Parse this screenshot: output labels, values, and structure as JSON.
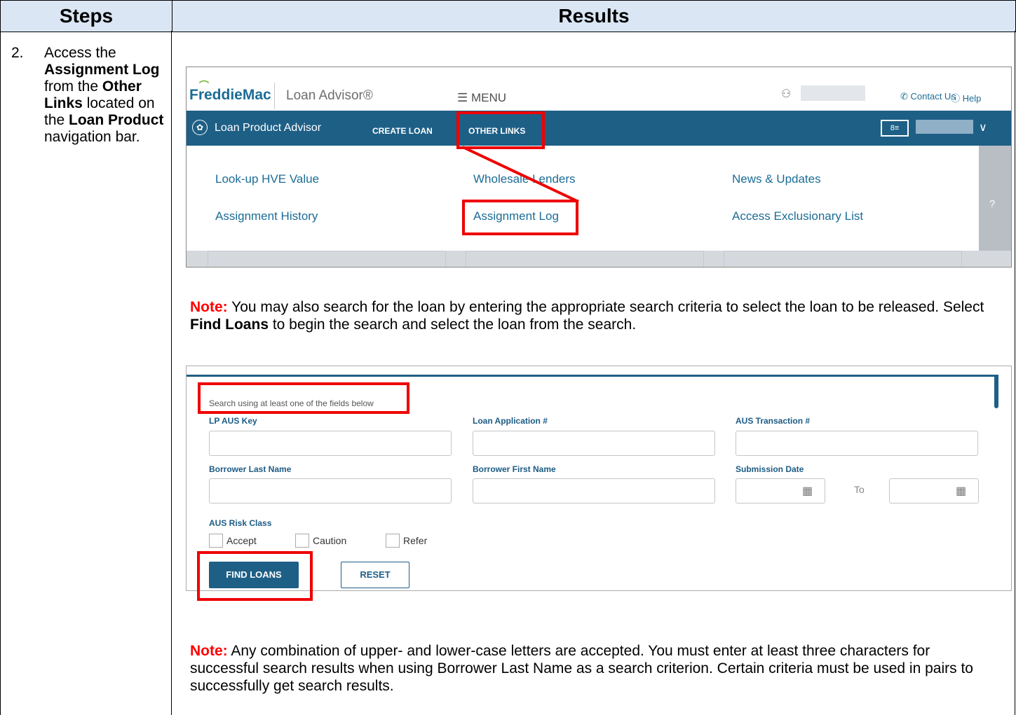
{
  "header": {
    "steps": "Steps",
    "results": "Results"
  },
  "step": {
    "number": "2.",
    "text_parts": [
      "Access the ",
      "Assignment Log",
      " from the ",
      "Other Links",
      " located on the ",
      "Loan Product",
      " navigation bar."
    ]
  },
  "screenshot1": {
    "logo_freddie": "Freddie",
    "logo_mac": "Mac",
    "loan_advisor": "Loan Advisor®",
    "menu": "☰ MENU",
    "contact_us": "Contact Us",
    "help": "Help",
    "nav": {
      "product": "Loan Product Advisor",
      "create_loan": "CREATE LOAN",
      "other_links": "OTHER LINKS"
    },
    "links": {
      "lookup_hve": "Look-up HVE Value",
      "wholesale": "Wholesale Lenders",
      "news": "News & Updates",
      "assignment_history": "Assignment History",
      "assignment_log": "Assignment Log",
      "exclusionary": "Access Exclusionary List"
    }
  },
  "note1": {
    "label": "Note:",
    "text_a": " You may also search for the loan by entering the appropriate search criteria to select the loan to be released. Select ",
    "bold": "Find Loans",
    "text_b": " to begin the search and select the loan from the search."
  },
  "screenshot2": {
    "hint": "Search using at least one of the fields below",
    "labels": {
      "lp_aus_key": "LP AUS Key",
      "loan_app": "Loan Application #",
      "aus_txn": "AUS Transaction #",
      "last_name": "Borrower Last Name",
      "first_name": "Borrower First Name",
      "submission_date": "Submission Date",
      "to": "To",
      "risk_class": "AUS Risk Class"
    },
    "checkboxes": [
      "Accept",
      "Caution",
      "Refer"
    ],
    "find_button": "FIND LOANS",
    "reset_button": "RESET"
  },
  "note2": {
    "label": "Note:",
    "text": " Any combination of upper- and lower-case letters are accepted. You must enter at least three characters for successful search results when using Borrower Last Name as a search criterion. Certain criteria must be used in pairs to successfully get search results."
  },
  "colors": {
    "header_bg": "#dae6f3",
    "nav_blue": "#1e5f86",
    "highlight_red": "#e00000",
    "note_red": "#ff0000"
  }
}
